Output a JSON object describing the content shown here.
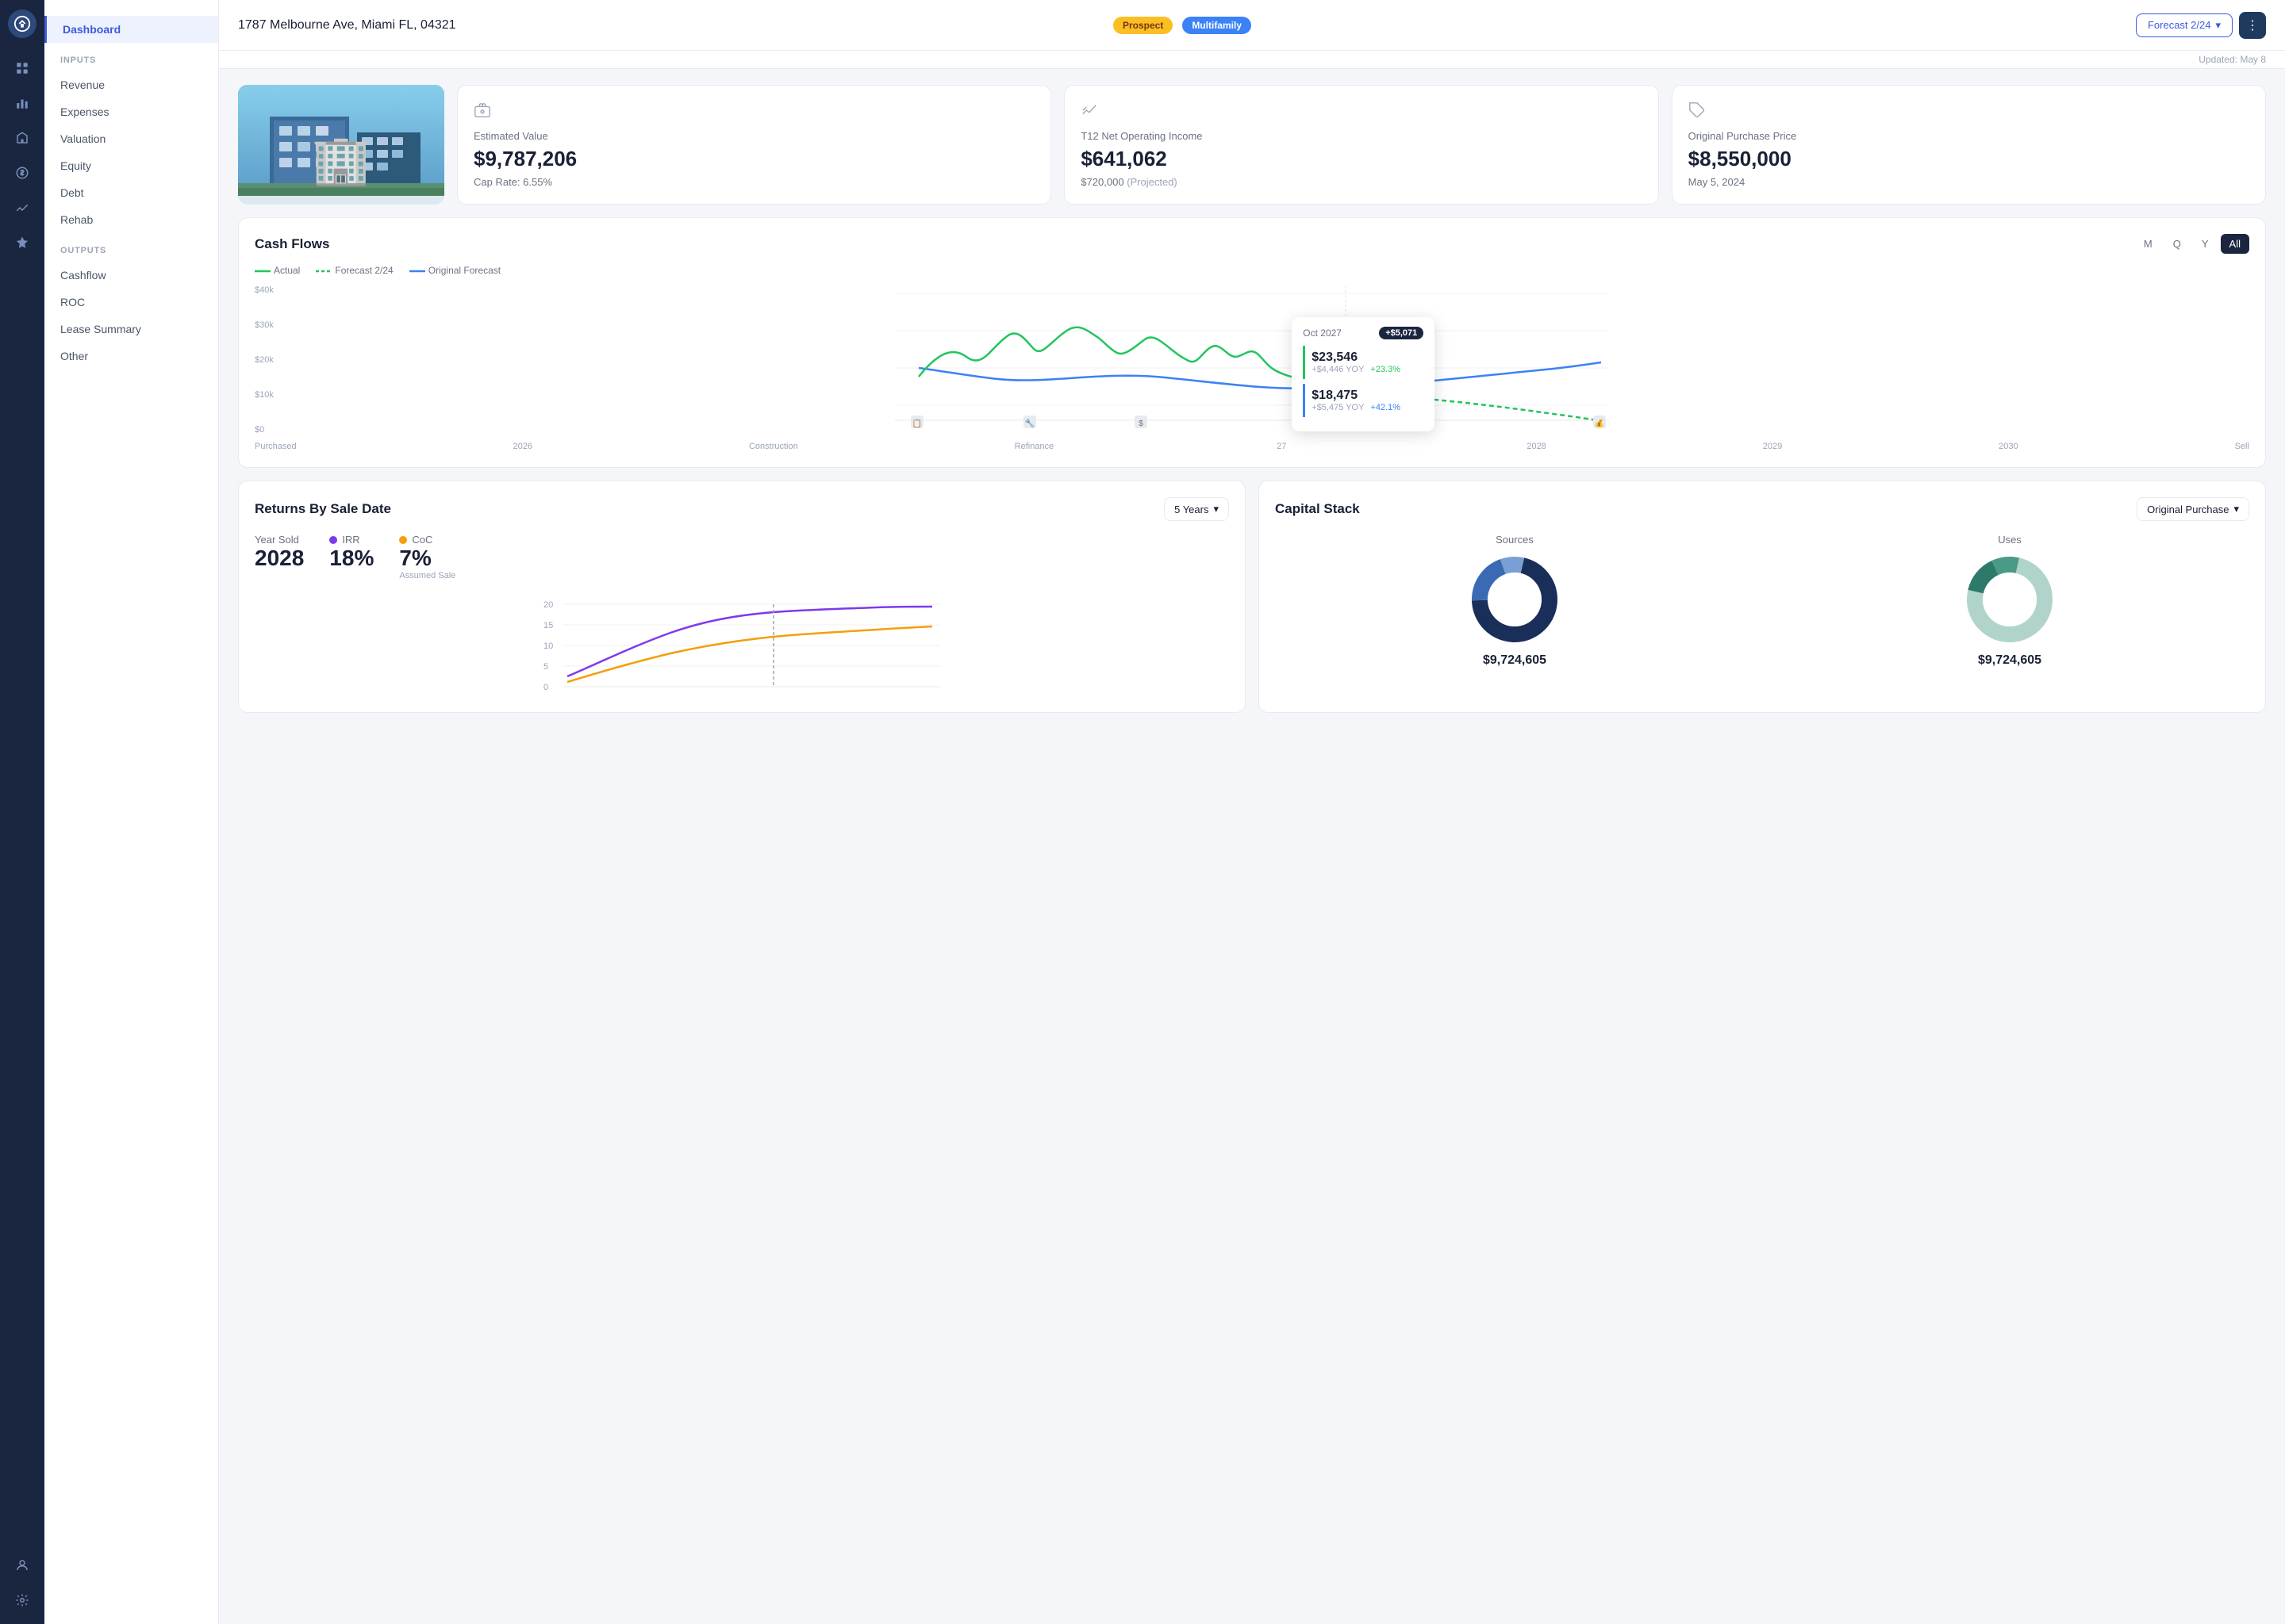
{
  "app": {
    "logo": "🏢"
  },
  "topbar": {
    "address": "1787 Melbourne Ave, Miami FL, 04321",
    "badge_prospect": "Prospect",
    "badge_multifamily": "Multifamily",
    "forecast_label": "Forecast 2/24",
    "updated_label": "Updated: May 8"
  },
  "sidebar": {
    "inputs_label": "INPUTS",
    "outputs_label": "OUTPUTS",
    "items": [
      {
        "id": "dashboard",
        "label": "Dashboard",
        "active": true
      },
      {
        "id": "revenue",
        "label": "Revenue",
        "active": false
      },
      {
        "id": "expenses",
        "label": "Expenses",
        "active": false
      },
      {
        "id": "valuation",
        "label": "Valuation",
        "active": false
      },
      {
        "id": "equity",
        "label": "Equity",
        "active": false
      },
      {
        "id": "debt",
        "label": "Debt",
        "active": false
      },
      {
        "id": "rehab",
        "label": "Rehab",
        "active": false
      },
      {
        "id": "cashflow",
        "label": "Cashflow",
        "active": false
      },
      {
        "id": "roc",
        "label": "ROC",
        "active": false
      },
      {
        "id": "lease_summary",
        "label": "Lease Summary",
        "active": false
      },
      {
        "id": "other",
        "label": "Other",
        "active": false
      }
    ]
  },
  "cards": {
    "estimated_value": {
      "label": "Estimated Value",
      "value": "$9,787,206",
      "sub": "Cap Rate: 6.55%"
    },
    "t12_noi": {
      "label": "T12 Net Operating Income",
      "value": "$641,062",
      "sub": "$720,000",
      "sub2": "(Projected)"
    },
    "purchase_price": {
      "label": "Original Purchase Price",
      "value": "$8,550,000",
      "sub": "May 5, 2024"
    }
  },
  "cash_flows": {
    "title": "Cash Flows",
    "periods": [
      "M",
      "Q",
      "Y",
      "All"
    ],
    "active_period": "All",
    "legend": [
      {
        "label": "Actual",
        "color": "#22c55e",
        "style": "solid"
      },
      {
        "label": "Forecast 2/24",
        "color": "#22c55e",
        "style": "dashed"
      },
      {
        "label": "Original Forecast",
        "color": "#3b82f6",
        "style": "solid"
      }
    ],
    "y_labels": [
      "$40k",
      "$30k",
      "$20k",
      "$10k",
      "$0"
    ],
    "x_labels": [
      "Purchased",
      "2026",
      "Construction",
      "Refinance",
      "2027",
      "2028",
      "2029",
      "2030",
      "Sell"
    ],
    "tooltip": {
      "date": "Oct 2027",
      "change": "+$5,071",
      "row1": {
        "value": "$23,546",
        "yoy": "+$4,446 YOY",
        "pct": "+23.3%"
      },
      "row2": {
        "value": "$18,475",
        "yoy": "+$5,475 YOY",
        "pct": "+42.1%"
      }
    }
  },
  "returns": {
    "title": "Returns By Sale Date",
    "dropdown": "5 Years",
    "year_label": "Year Sold",
    "year_val": "2028",
    "irr_label": "IRR",
    "irr_val": "18%",
    "coc_label": "CoC",
    "coc_val": "7%",
    "assumed_sale": "Assumed Sale"
  },
  "capital_stack": {
    "title": "Capital Stack",
    "dropdown": "Original Purchase",
    "sources_label": "Sources",
    "uses_label": "Uses",
    "sources_amount": "$9,724,605",
    "uses_amount": "$9,724,605"
  }
}
